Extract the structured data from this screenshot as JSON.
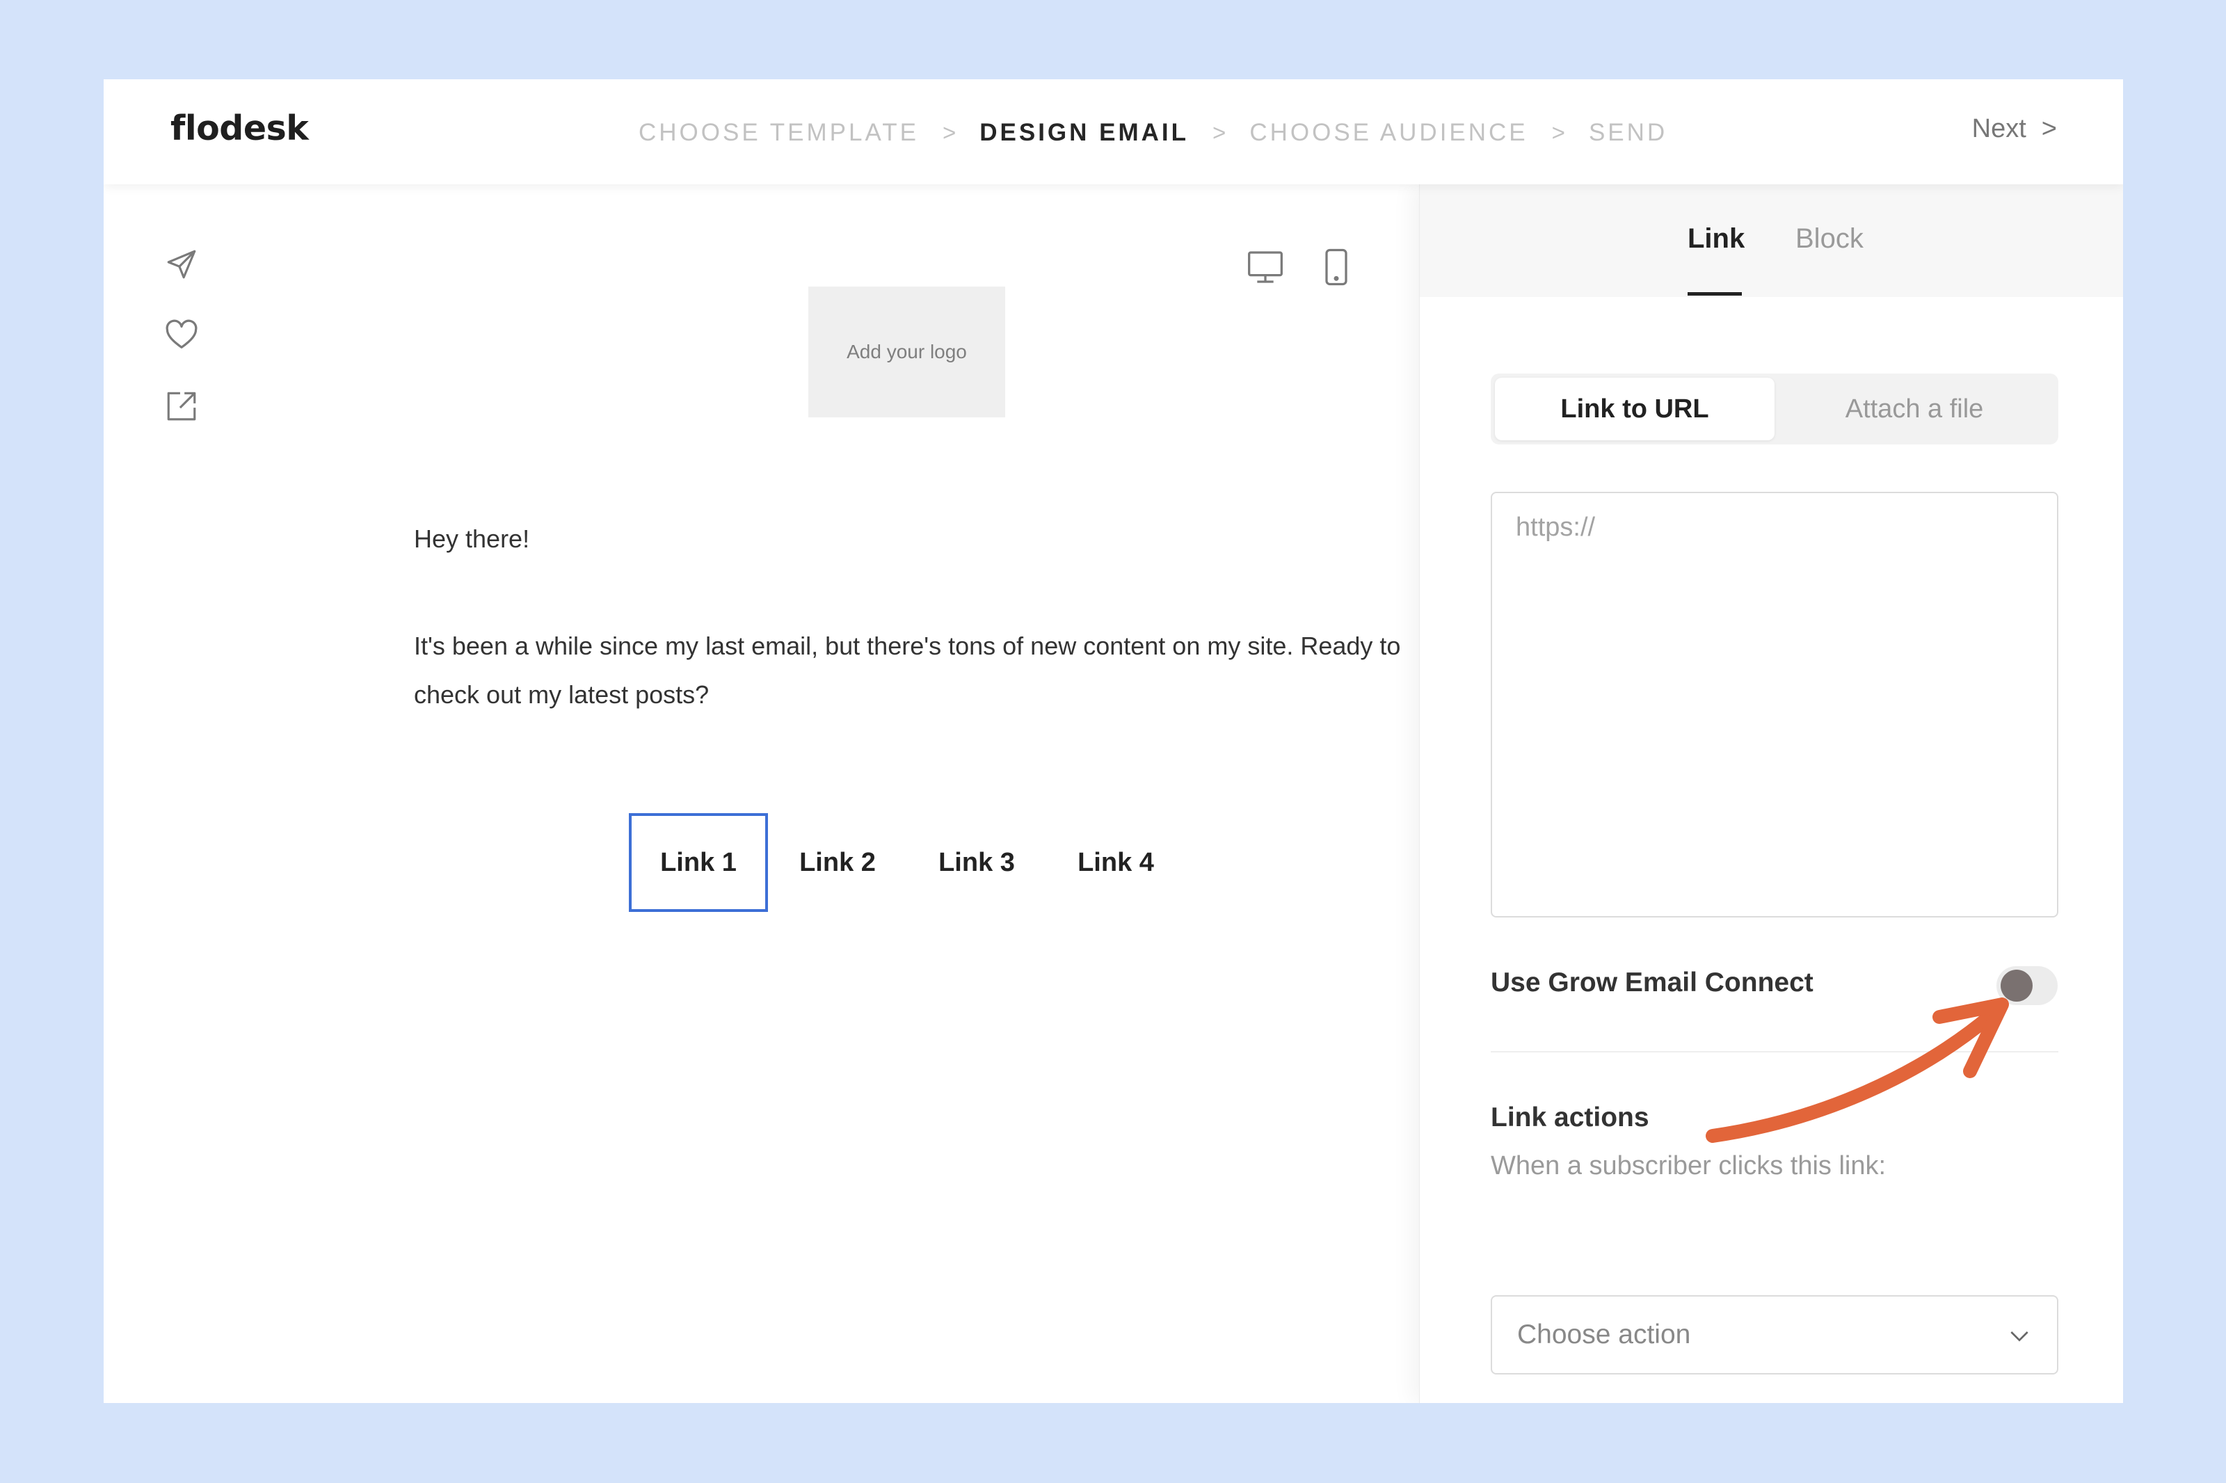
{
  "app": {
    "logo_text": "flodesk"
  },
  "steps": [
    {
      "label": "CHOOSE TEMPLATE",
      "active": false
    },
    {
      "label": "DESIGN EMAIL",
      "active": true
    },
    {
      "label": "CHOOSE AUDIENCE",
      "active": false
    },
    {
      "label": "SEND",
      "active": false
    }
  ],
  "step_separator": ">",
  "header": {
    "next_label": "Next",
    "next_chevron": ">"
  },
  "sidebar_icons": [
    "send-icon",
    "heart-icon",
    "external-link-icon"
  ],
  "preview_icons": [
    "desktop-icon",
    "mobile-icon"
  ],
  "email": {
    "logo_placeholder": "Add your logo",
    "greeting": "Hey there!",
    "body": "It's been a while since my last email, but there's tons of new content on my site. Ready to check out my latest posts?",
    "links": [
      "Link 1",
      "Link 2",
      "Link 3",
      "Link 4"
    ],
    "selected_link": "Link 1"
  },
  "panel": {
    "tabs": [
      "Link",
      "Block"
    ],
    "active_tab": "Link",
    "segment": {
      "options": [
        "Link to URL",
        "Attach a file"
      ],
      "active": "Link to URL"
    },
    "url_placeholder": "https://",
    "url_value": "",
    "toggle": {
      "label": "Use Grow Email Connect",
      "on": false
    },
    "link_actions": {
      "title": "Link actions",
      "subtitle": "When a subscriber clicks this link:",
      "select_placeholder": "Choose action"
    }
  },
  "colors": {
    "background": "#d4e3fa",
    "selected_link_border": "#3d6fd6",
    "annotation_arrow": "#e2653a",
    "toggle_knob": "#7a7170"
  }
}
